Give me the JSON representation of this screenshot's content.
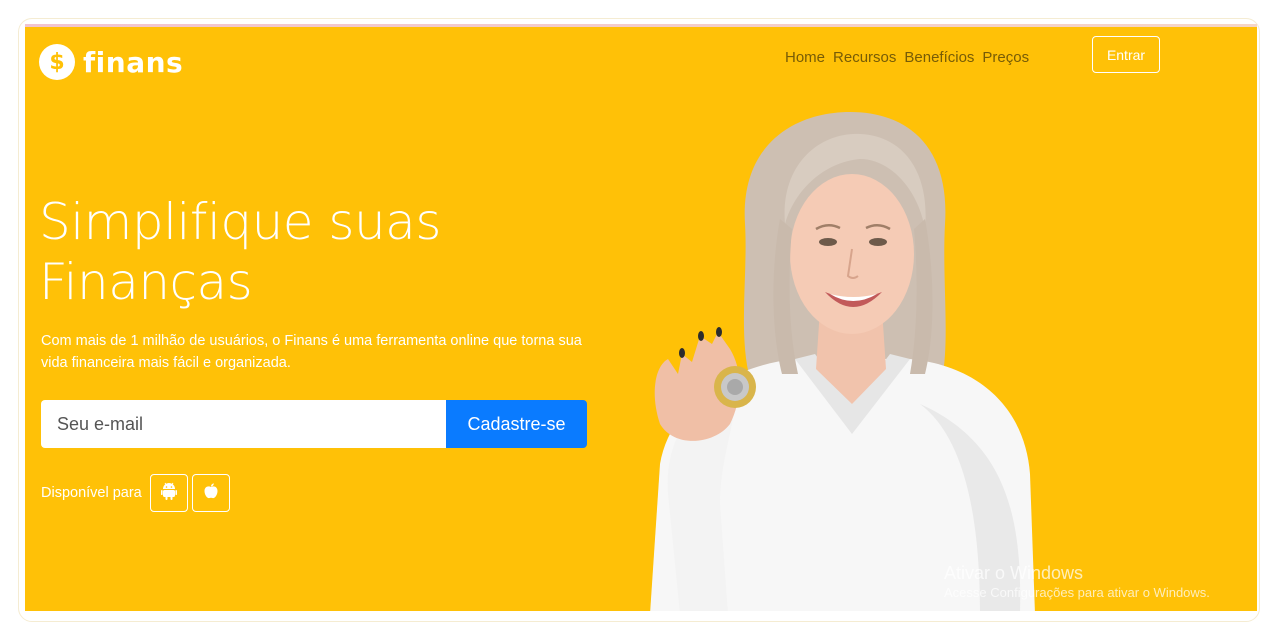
{
  "brand": {
    "name": "finans",
    "icon": "dollar-icon",
    "color": "#ffc107"
  },
  "nav": {
    "items": [
      "Home",
      "Recursos",
      "Benefícios",
      "Preços"
    ],
    "login_label": "Entrar"
  },
  "hero": {
    "headline_line1": "Simplifique suas",
    "headline_line2": "Finanças",
    "subtitle": "Com mais de 1 milhão de usuários, o Finans é uma ferramenta online que torna sua vida financeira mais fácil e organizada.",
    "email_placeholder": "Seu e-mail",
    "signup_label": "Cadastre-se",
    "signup_color": "#0a7bff",
    "available_label": "Disponível para",
    "stores": [
      "android-icon",
      "apple-icon"
    ]
  },
  "watermark": {
    "title": "Ativar o Windows",
    "subtitle": "Acesse Configurações para ativar o Windows."
  }
}
